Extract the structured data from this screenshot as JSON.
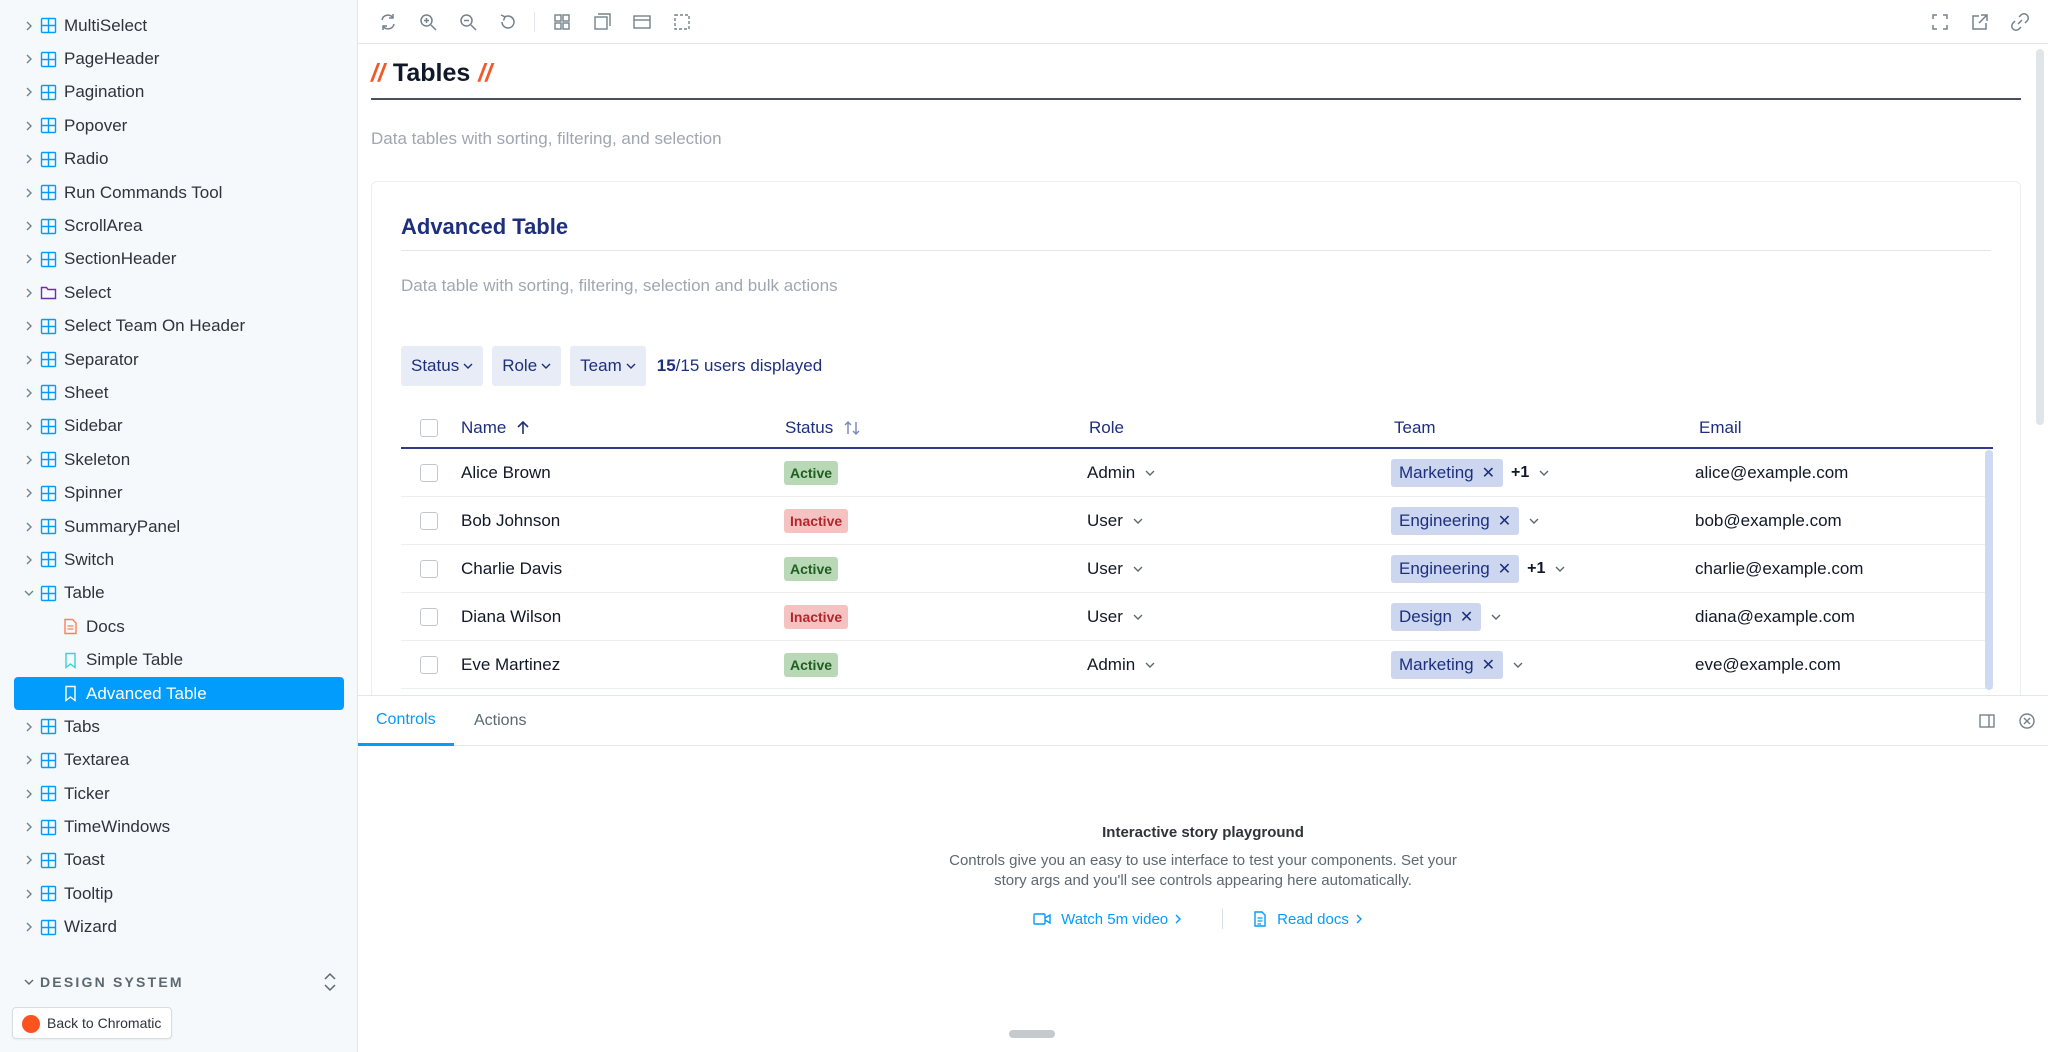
{
  "sidebar": {
    "items": [
      {
        "label": "MultiSelect",
        "icon": "component-icon",
        "expanded": false
      },
      {
        "label": "PageHeader",
        "icon": "component-icon",
        "expanded": false
      },
      {
        "label": "Pagination",
        "icon": "component-icon",
        "expanded": false
      },
      {
        "label": "Popover",
        "icon": "component-icon",
        "expanded": false
      },
      {
        "label": "Radio",
        "icon": "component-icon",
        "expanded": false
      },
      {
        "label": "Run Commands Tool",
        "icon": "component-icon",
        "expanded": false
      },
      {
        "label": "ScrollArea",
        "icon": "component-icon",
        "expanded": false
      },
      {
        "label": "SectionHeader",
        "icon": "component-icon",
        "expanded": false
      },
      {
        "label": "Select",
        "icon": "folder-icon",
        "expanded": false
      },
      {
        "label": "Select Team On Header",
        "icon": "component-icon",
        "expanded": false
      },
      {
        "label": "Separator",
        "icon": "component-icon",
        "expanded": false
      },
      {
        "label": "Sheet",
        "icon": "component-icon",
        "expanded": false
      },
      {
        "label": "Sidebar",
        "icon": "component-icon",
        "expanded": false
      },
      {
        "label": "Skeleton",
        "icon": "component-icon",
        "expanded": false
      },
      {
        "label": "Spinner",
        "icon": "component-icon",
        "expanded": false
      },
      {
        "label": "SummaryPanel",
        "icon": "component-icon",
        "expanded": false
      },
      {
        "label": "Switch",
        "icon": "component-icon",
        "expanded": false
      },
      {
        "label": "Table",
        "icon": "component-icon",
        "expanded": true
      },
      {
        "label": "Docs",
        "icon": "docs-icon",
        "child": true
      },
      {
        "label": "Simple Table",
        "icon": "bookmark-icon",
        "child": true
      },
      {
        "label": "Advanced Table",
        "icon": "bookmark-icon",
        "child": true,
        "selected": true
      },
      {
        "label": "Tabs",
        "icon": "component-icon",
        "expanded": false
      },
      {
        "label": "Textarea",
        "icon": "component-icon",
        "expanded": false
      },
      {
        "label": "Ticker",
        "icon": "component-icon",
        "expanded": false
      },
      {
        "label": "TimeWindows",
        "icon": "component-icon",
        "expanded": false
      },
      {
        "label": "Toast",
        "icon": "component-icon",
        "expanded": false
      },
      {
        "label": "Tooltip",
        "icon": "component-icon",
        "expanded": false
      },
      {
        "label": "Wizard",
        "icon": "component-icon",
        "expanded": false
      }
    ],
    "section_label": "DESIGN SYSTEM",
    "back_button": "Back to Chromatic"
  },
  "canvas": {
    "page_title": "Tables",
    "title_slash": "//",
    "page_description": "Data tables with sorting, filtering, and selection",
    "card_title": "Advanced Table",
    "card_description": "Data table with sorting, filtering, selection and bulk actions",
    "filters": [
      "Status",
      "Role",
      "Team"
    ],
    "count_shown": "15",
    "count_rest": "/15 users displayed",
    "columns": [
      "Name",
      "Status",
      "Role",
      "Team",
      "Email"
    ],
    "rows": [
      {
        "name": "Alice Brown",
        "status": "Active",
        "role": "Admin",
        "team": "Marketing",
        "more": "+1",
        "email": "alice@example.com"
      },
      {
        "name": "Bob Johnson",
        "status": "Inactive",
        "role": "User",
        "team": "Engineering",
        "more": "",
        "email": "bob@example.com"
      },
      {
        "name": "Charlie Davis",
        "status": "Active",
        "role": "User",
        "team": "Engineering",
        "more": "+1",
        "email": "charlie@example.com"
      },
      {
        "name": "Diana Wilson",
        "status": "Inactive",
        "role": "User",
        "team": "Design",
        "more": "",
        "email": "diana@example.com"
      },
      {
        "name": "Eve Martinez",
        "status": "Active",
        "role": "Admin",
        "team": "Marketing",
        "more": "",
        "email": "eve@example.com"
      }
    ]
  },
  "panel": {
    "tabs": [
      "Controls",
      "Actions"
    ],
    "empty_title": "Interactive story playground",
    "empty_description": "Controls give you an easy to use interface to test your components. Set your story args and you'll see controls appearing here automatically.",
    "link_video": "Watch 5m video",
    "link_docs": "Read docs"
  },
  "colors": {
    "accent": "#029cfd",
    "title_navy": "#1d2f7d",
    "slash_orange": "#f05a28",
    "active_badge": "#b9d8b6",
    "inactive_badge": "#f5c2c2",
    "tag_bg": "#ccd6ee"
  }
}
